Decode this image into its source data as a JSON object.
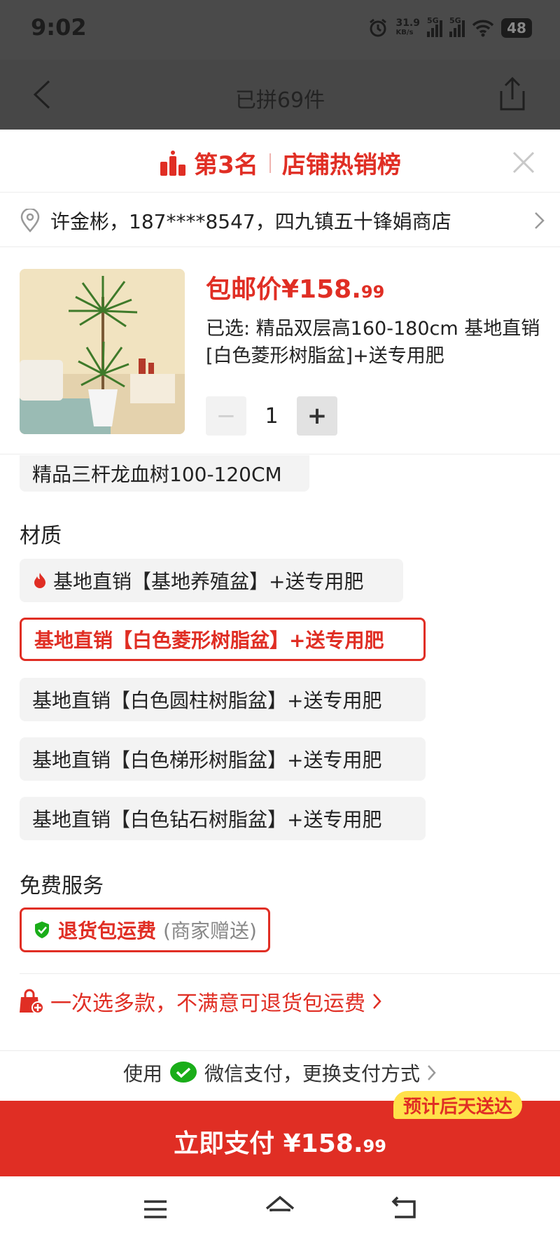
{
  "status_bar": {
    "time": "9:02",
    "net_speed": "31.9",
    "net_unit": "KB/s",
    "sig1": "5G",
    "sig2": "5G",
    "battery": "48"
  },
  "nav": {
    "title": "已拼69件"
  },
  "rank": {
    "place": "第3名",
    "board": "店铺热销榜"
  },
  "address": {
    "text": "许金彬，187****8547，四九镇五十锋娟商店"
  },
  "product": {
    "price_prefix": "包邮价¥158.",
    "price_cents": "99",
    "selected": "已选: 精品双层高160-180cm 基地直销[白色菱形树脂盆]+送专用肥",
    "quantity": "1"
  },
  "spec_partial": "精品三杆龙血树100-120CM",
  "material": {
    "label": "材质",
    "options": [
      {
        "label": "基地直销【基地养殖盆】+送专用肥"
      },
      {
        "label": "基地直销【白色菱形树脂盆】+送专用肥"
      },
      {
        "label": "基地直销【白色圆柱树脂盆】+送专用肥"
      },
      {
        "label": "基地直销【白色梯形树脂盆】+送专用肥"
      },
      {
        "label": "基地直销【白色钻石树脂盆】+送专用肥"
      }
    ]
  },
  "free_service": {
    "label": "免费服务",
    "name": "退货包运费",
    "note": "(商家赠送)"
  },
  "promo": {
    "text": "一次选多款，不满意可退货包运费"
  },
  "payment": {
    "prefix": "使用",
    "text": "微信支付，更换支付方式"
  },
  "pay_button": {
    "label": "立即支付 ¥158.",
    "cents": "99"
  },
  "eta": "预计后天送达",
  "colors": {
    "accent": "#e02e24",
    "badge": "#ffe14a",
    "wechat": "#1aad19"
  }
}
